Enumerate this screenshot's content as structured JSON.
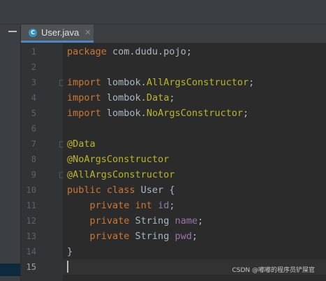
{
  "tab": {
    "icon": "C",
    "label": "User.java",
    "close": "✕"
  },
  "gutter": {
    "lines": [
      "1",
      "2",
      "3",
      "4",
      "5",
      "6",
      "7",
      "8",
      "9",
      "10",
      "11",
      "12",
      "13",
      "14",
      "15"
    ],
    "current_line": 15
  },
  "code": [
    [
      [
        "kw",
        "package"
      ],
      [
        "txt",
        " com.dudu.pojo;"
      ]
    ],
    [],
    [
      [
        "kw",
        "import"
      ],
      [
        "txt",
        " lombok."
      ],
      [
        "ann",
        "AllArgsConstructor"
      ],
      [
        "txt",
        ";"
      ]
    ],
    [
      [
        "kw",
        "import"
      ],
      [
        "txt",
        " lombok."
      ],
      [
        "ann",
        "Data"
      ],
      [
        "txt",
        ";"
      ]
    ],
    [
      [
        "kw",
        "import"
      ],
      [
        "txt",
        " lombok."
      ],
      [
        "ann",
        "NoArgsConstructor"
      ],
      [
        "txt",
        ";"
      ]
    ],
    [],
    [
      [
        "ann",
        "@Data"
      ]
    ],
    [
      [
        "ann",
        "@NoArgsConstructor"
      ]
    ],
    [
      [
        "ann",
        "@AllArgsConstructor"
      ]
    ],
    [
      [
        "kw",
        "public class"
      ],
      [
        "txt",
        " User {"
      ]
    ],
    [
      [
        "txt",
        "    "
      ],
      [
        "kw",
        "private int"
      ],
      [
        "txt",
        " "
      ],
      [
        "fld",
        "id"
      ],
      [
        "txt",
        ";"
      ]
    ],
    [
      [
        "txt",
        "    "
      ],
      [
        "kw",
        "private"
      ],
      [
        "txt",
        " String "
      ],
      [
        "fld",
        "name"
      ],
      [
        "txt",
        ";"
      ]
    ],
    [
      [
        "txt",
        "    "
      ],
      [
        "kw",
        "private"
      ],
      [
        "txt",
        " String "
      ],
      [
        "fld",
        "pwd"
      ],
      [
        "txt",
        ";"
      ]
    ],
    [
      [
        "txt",
        "}"
      ]
    ],
    []
  ],
  "fold_markers": [
    3,
    7,
    9
  ],
  "watermark": "CSDN @嘟嘟的程序员铲屎官",
  "colors": {
    "background": "#2b2b2b",
    "keyword": "#cc7832",
    "annotation": "#bbb529",
    "field": "#9876aa",
    "text": "#a9b7c6",
    "tab_underline": "#4a88c7"
  }
}
